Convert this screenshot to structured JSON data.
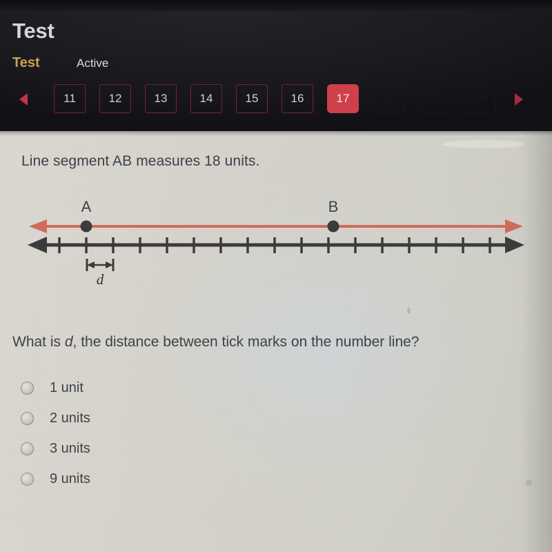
{
  "header": {
    "app_title": "Test",
    "tab_label": "Test",
    "status_label": "Active",
    "accent_color": "#d0404a",
    "tab_active_color": "#cda24e",
    "background_color": "#1c1c21"
  },
  "pager": {
    "prev_icon": "left-triangle-icon",
    "next_icon": "right-triangle-icon",
    "current": "17",
    "items": [
      {
        "label": "11",
        "state": "normal"
      },
      {
        "label": "12",
        "state": "normal"
      },
      {
        "label": "13",
        "state": "normal"
      },
      {
        "label": "14",
        "state": "normal"
      },
      {
        "label": "15",
        "state": "normal"
      },
      {
        "label": "16",
        "state": "normal"
      },
      {
        "label": "17",
        "state": "current"
      },
      {
        "label": "18",
        "state": "faded"
      },
      {
        "label": "19",
        "state": "faded"
      },
      {
        "label": "20",
        "state": "faded"
      }
    ]
  },
  "content": {
    "stem": "Line segment AB measures 18 units.",
    "question_prefix": "What is ",
    "question_variable": "d",
    "question_suffix": ", the distance between tick marks on the number line?",
    "text_color": "#3d4148",
    "paper_color": "#d9d7cf"
  },
  "figure": {
    "point_a_label": "A",
    "point_b_label": "B",
    "distance_label": "d",
    "segment_color": "#cf6b5c",
    "axis_color": "#3b3b3b",
    "point_color": "#3b3b3b",
    "tick_count": 19,
    "tick_spacing_px": 39,
    "point_a_tick_index": 1,
    "point_b_tick_index": 10,
    "segment_length_units": 18
  },
  "choices": [
    {
      "label": "1 unit",
      "selected": false
    },
    {
      "label": "2 units",
      "selected": false
    },
    {
      "label": "3 units",
      "selected": false
    },
    {
      "label": "9 units",
      "selected": false
    }
  ]
}
